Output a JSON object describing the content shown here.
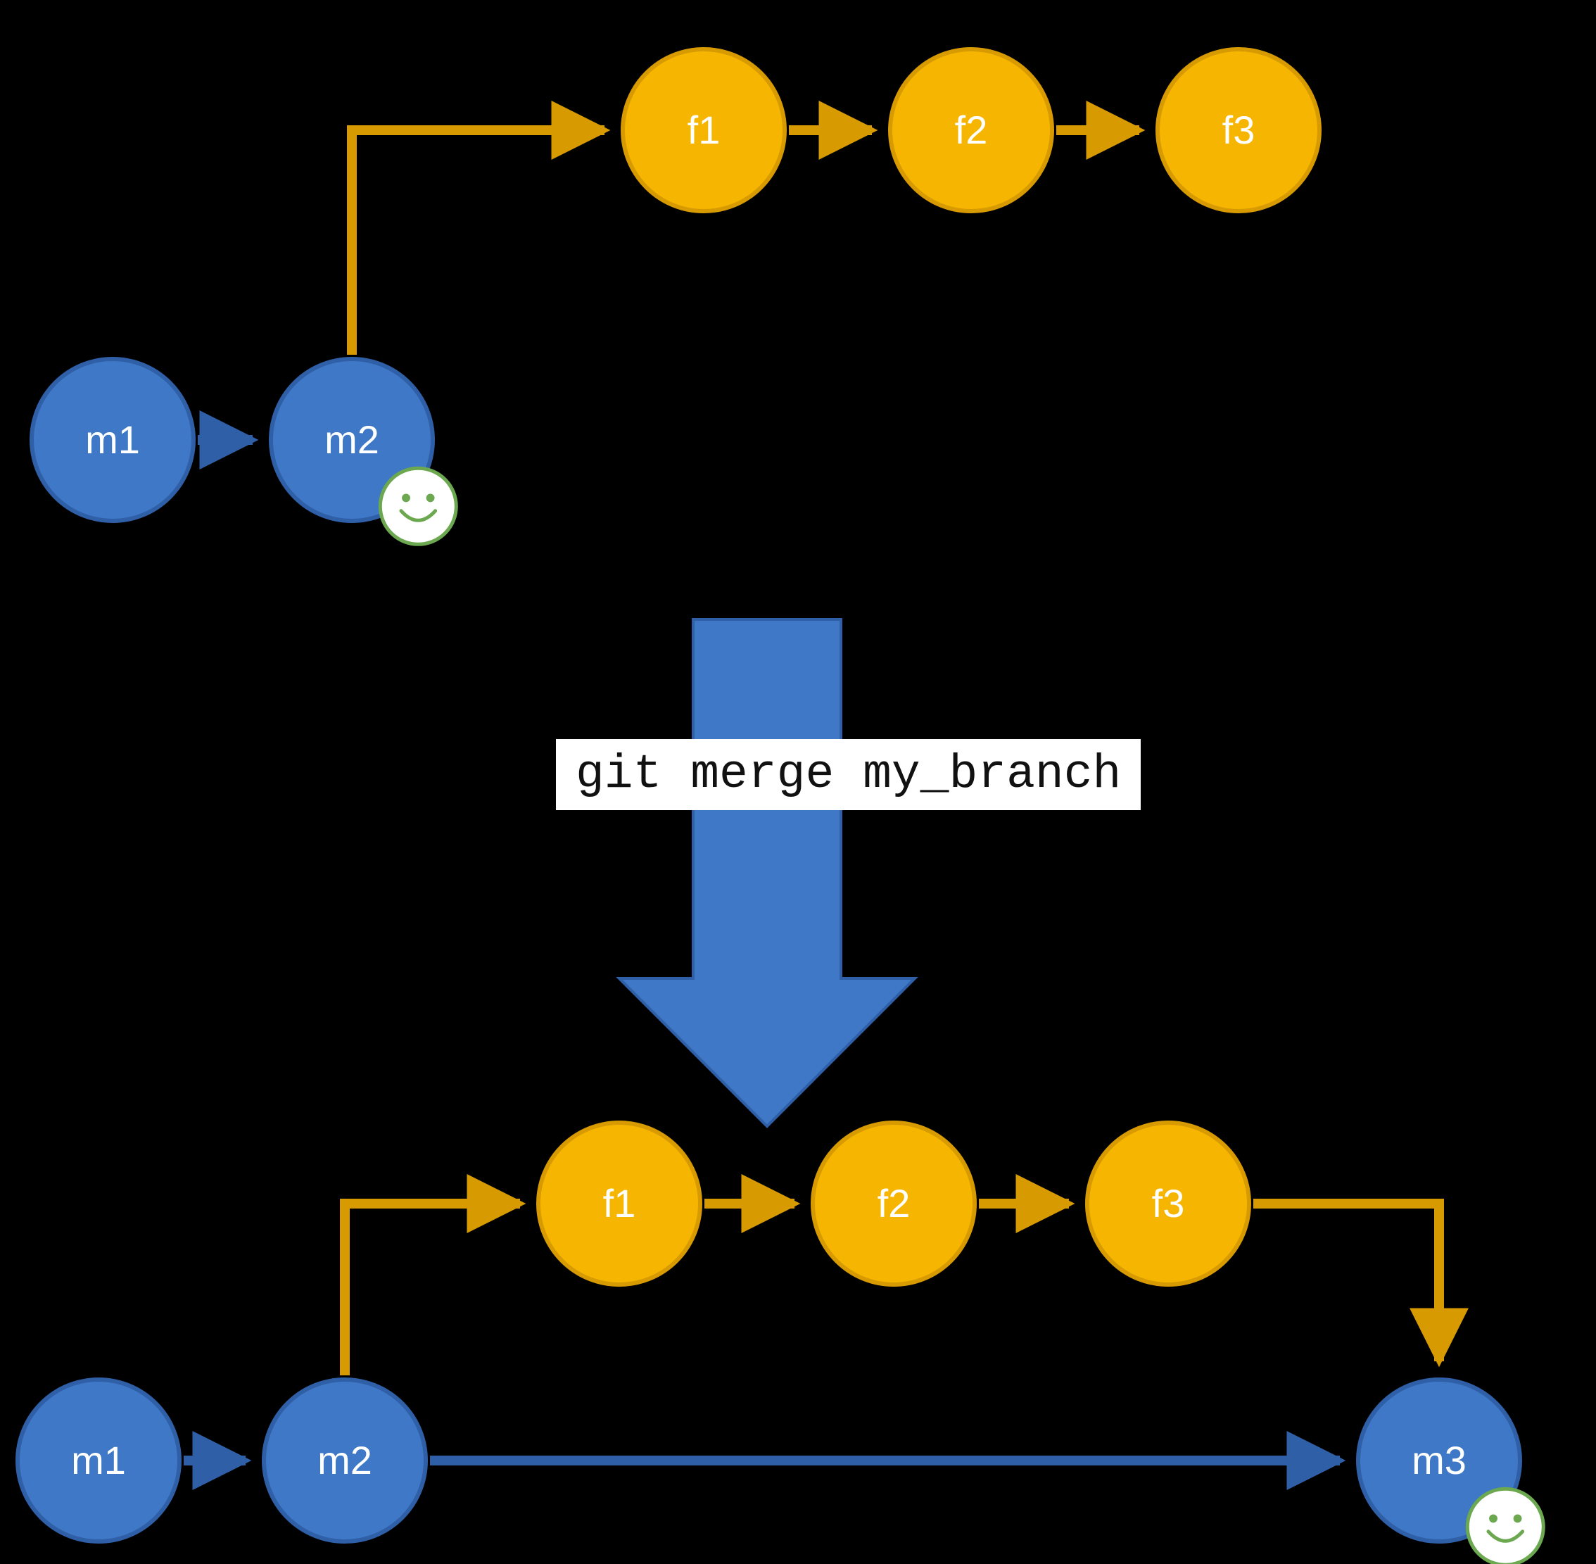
{
  "colors": {
    "blue": "#3E78C6",
    "blueStroke": "#2F5FA6",
    "gold": "#F6B500",
    "goldStroke": "#D79A00",
    "green": "#6BA84F",
    "white": "#FFFFFF",
    "black": "#000000"
  },
  "command": {
    "text": "git merge my_branch"
  },
  "before": {
    "main": [
      {
        "id": "m1",
        "label": "m1",
        "smile": false
      },
      {
        "id": "m2",
        "label": "m2",
        "smile": true
      }
    ],
    "feature": [
      {
        "id": "f1",
        "label": "f1"
      },
      {
        "id": "f2",
        "label": "f2"
      },
      {
        "id": "f3",
        "label": "f3"
      }
    ]
  },
  "after": {
    "main": [
      {
        "id": "m1",
        "label": "m1",
        "smile": false
      },
      {
        "id": "m2",
        "label": "m2",
        "smile": false
      },
      {
        "id": "m3",
        "label": "m3",
        "smile": true
      }
    ],
    "feature": [
      {
        "id": "f1",
        "label": "f1"
      },
      {
        "id": "f2",
        "label": "f2"
      },
      {
        "id": "f3",
        "label": "f3"
      }
    ]
  }
}
